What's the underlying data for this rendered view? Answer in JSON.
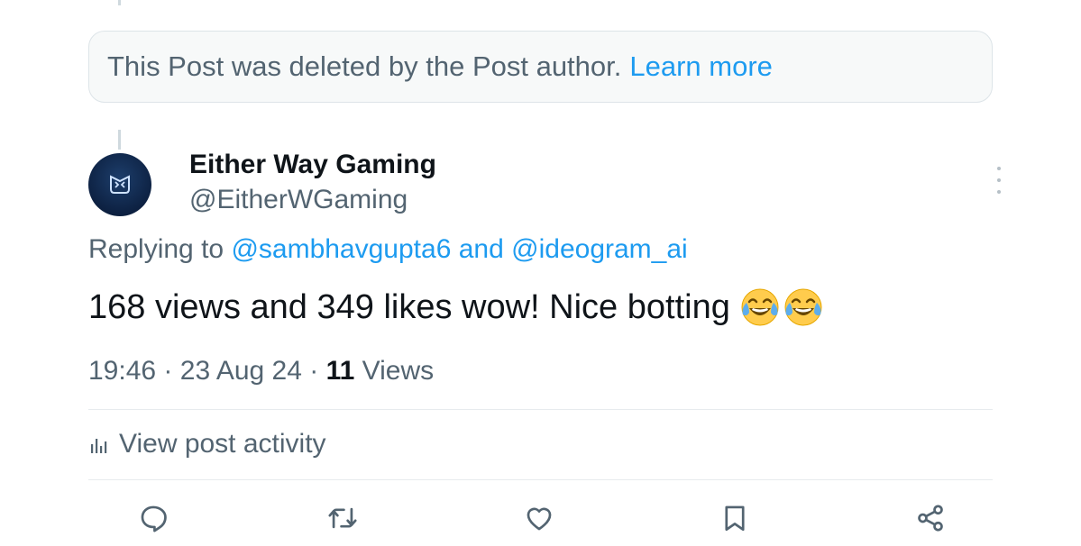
{
  "deleted_notice": {
    "text": "This Post was deleted by the Post author.",
    "link": "Learn more"
  },
  "post": {
    "author_name": "Either Way Gaming",
    "author_handle": "@EitherWGaming",
    "replying_prefix": "Replying to",
    "reply_mentions": [
      "@sambhavgupta6",
      "@ideogram_ai"
    ],
    "reply_joiner": "and",
    "text": "168 views and 349 likes wow! Nice botting",
    "emoji_icons": [
      "face-with-tears-of-joy-icon",
      "face-with-tears-of-joy-icon"
    ],
    "time": "19:46",
    "date": "23 Aug 24",
    "views_count": "11",
    "views_label": "Views",
    "separator": "·"
  },
  "activity": {
    "label": "View post activity",
    "icon": "analytics-icon"
  },
  "actions": [
    {
      "name": "reply",
      "icon": "reply-icon"
    },
    {
      "name": "repost",
      "icon": "repost-icon"
    },
    {
      "name": "like",
      "icon": "heart-icon"
    },
    {
      "name": "bookmark",
      "icon": "bookmark-icon"
    },
    {
      "name": "share",
      "icon": "share-icon"
    }
  ],
  "colors": {
    "text_primary": "#0f1419",
    "text_secondary": "#536471",
    "link": "#1d9bf0",
    "border": "#e7ebee"
  }
}
